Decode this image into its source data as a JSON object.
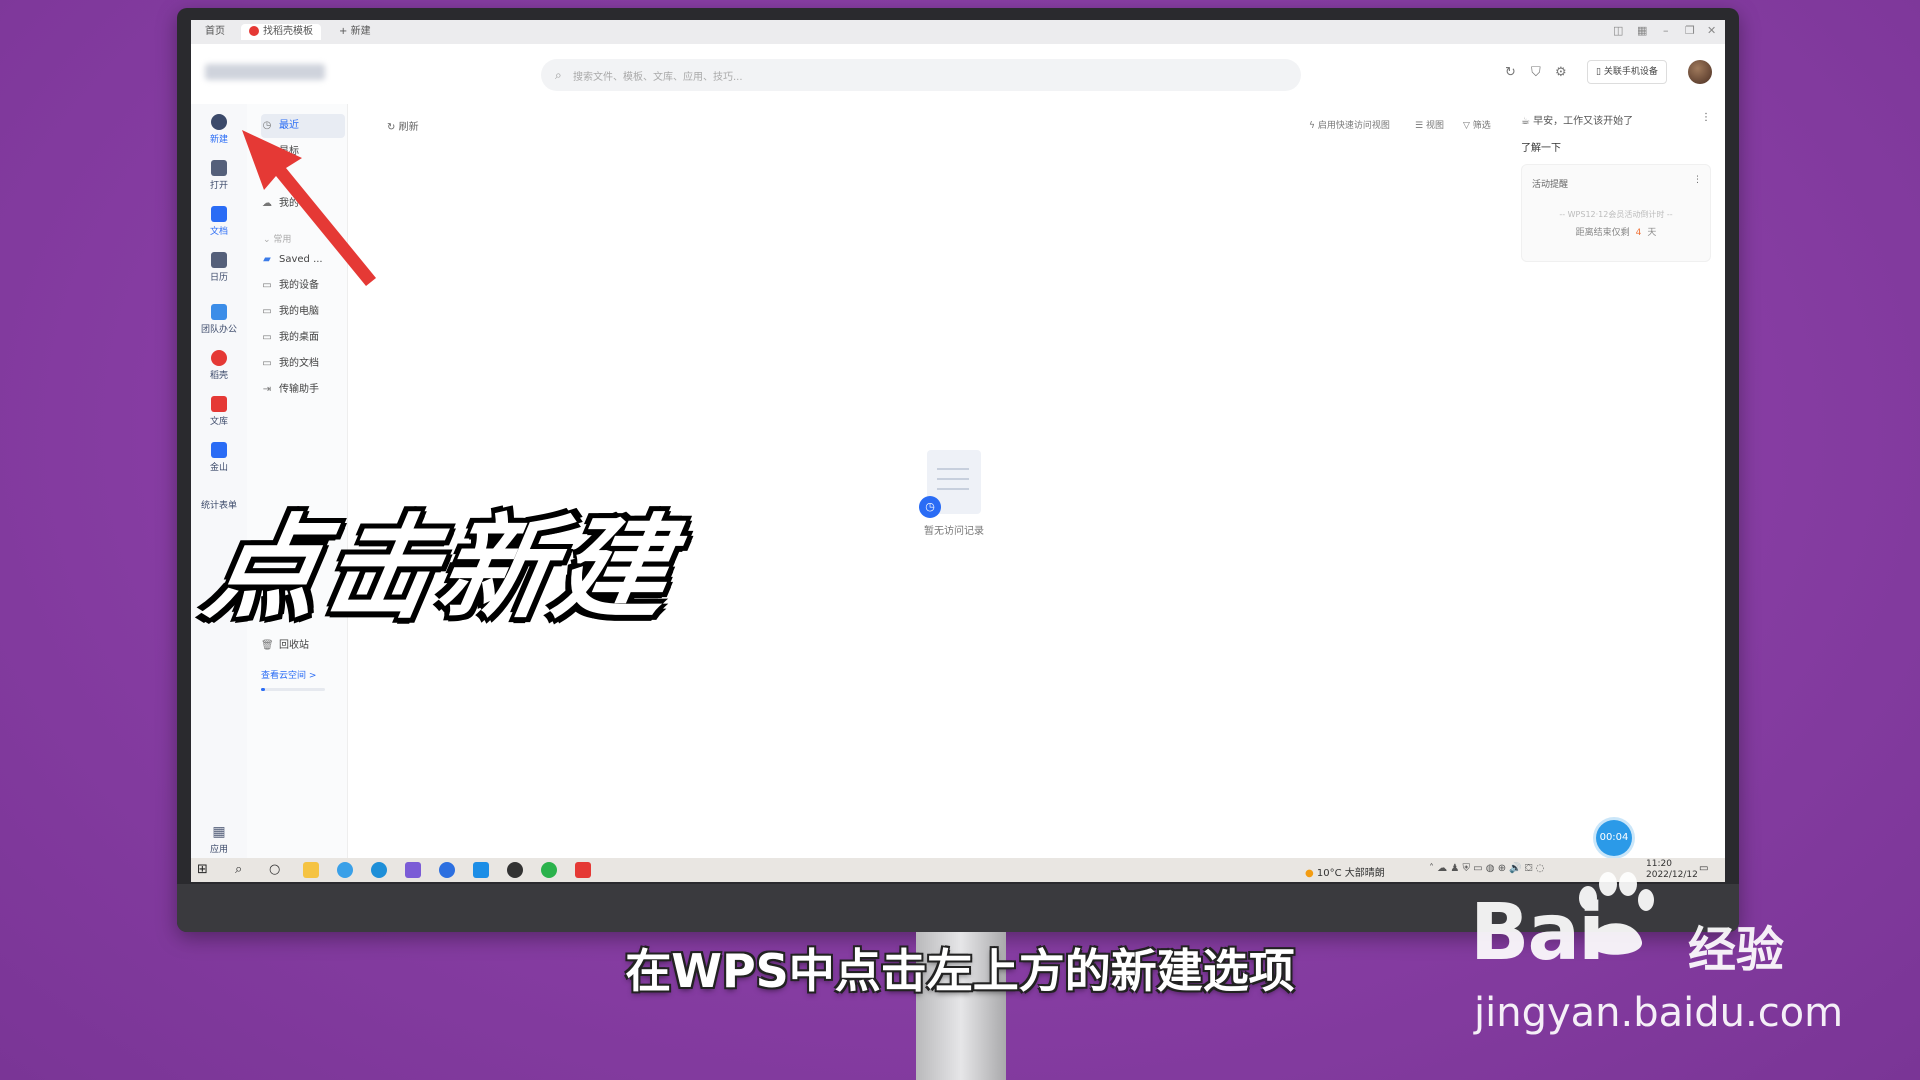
{
  "titlebar": {
    "tabs": [
      {
        "label": "首页"
      },
      {
        "label": "找稻壳模板"
      },
      {
        "label": "新建"
      }
    ],
    "new_tab_plus": "+"
  },
  "header": {
    "search_placeholder": "搜索文件、模板、文库、应用、技巧...",
    "link_device": "关联手机设备"
  },
  "rail": {
    "items": [
      {
        "label": "新建"
      },
      {
        "label": "打开"
      },
      {
        "label": "文档"
      },
      {
        "label": "日历"
      },
      {
        "label": "团队办公"
      },
      {
        "label": "稻壳"
      },
      {
        "label": "文库"
      },
      {
        "label": "金山"
      },
      {
        "label": "统计表单"
      },
      {
        "label": "应用"
      }
    ]
  },
  "subnav": {
    "items": [
      {
        "label": "最近"
      },
      {
        "label": "星标"
      },
      {
        "label": "享"
      },
      {
        "label": "我的"
      }
    ],
    "group_label": "常用",
    "common": [
      {
        "label": "Saved ..."
      },
      {
        "label": "我的设备"
      },
      {
        "label": "我的电脑"
      },
      {
        "label": "我的桌面"
      },
      {
        "label": "我的文档"
      },
      {
        "label": "传输助手"
      }
    ],
    "recycle": "回收站",
    "cloud": "查看云空间 >"
  },
  "main": {
    "refresh": "刷新",
    "quick_view": "启用快速访问视图",
    "view": "视图",
    "filter": "筛选",
    "empty": "暂无访问记录"
  },
  "right_panel": {
    "greeting": "早安，工作又该开始了",
    "learn": "了解一下",
    "card_title": "活动提醒",
    "card_line1": "-- WPS12·12会员活动倒计时 --",
    "card_line2_prefix": "距离结束仅剩",
    "card_days": "4",
    "card_line2_suffix": "天"
  },
  "timer": "00:04",
  "taskbar": {
    "weather": "10°C 大部晴朗",
    "time": "11:20",
    "date": "2022/12/12"
  },
  "overlay": {
    "big_text": "点击新建",
    "caption": "在WPS中点击左上方的新建选项"
  },
  "watermark": {
    "brand": "Bai",
    "brand_cn": "经验",
    "url": "jingyan.baidu.com"
  },
  "colors": {
    "background": "#8a3fa6",
    "accent": "#2a6cf5",
    "arrow": "#e53935",
    "countdown": "#f0743a"
  }
}
